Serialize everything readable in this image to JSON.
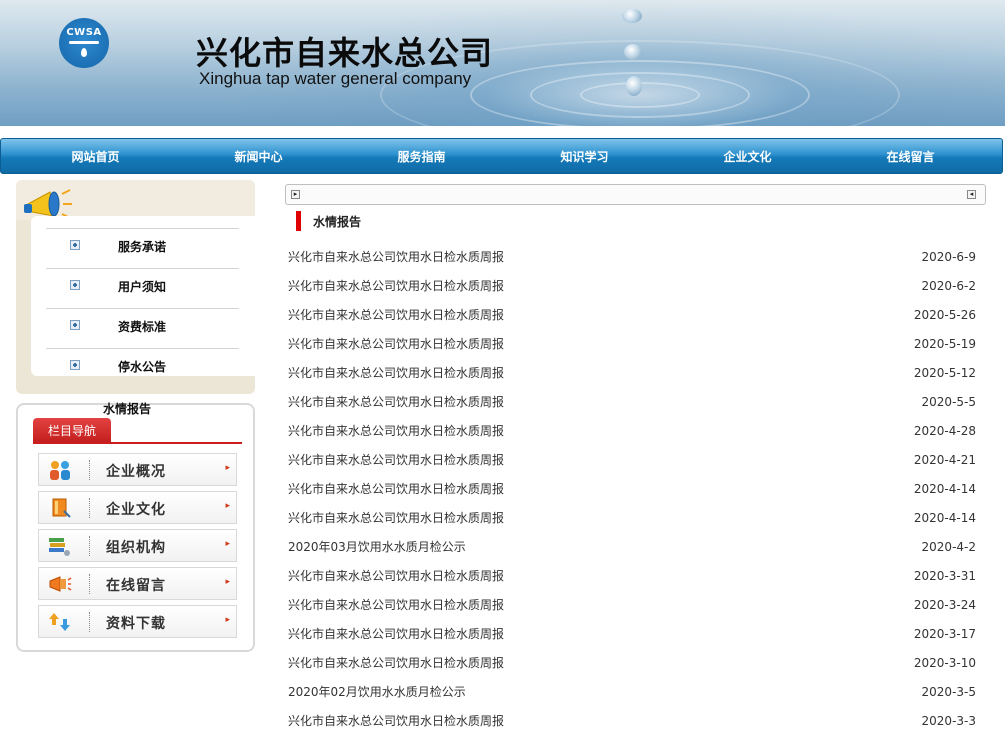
{
  "banner": {
    "logo_text": "CWSA",
    "title_cn": "兴化市自来水总公司",
    "title_en": "Xinghua tap water general company"
  },
  "nav": {
    "items": [
      "网站首页",
      "新闻中心",
      "服务指南",
      "知识学习",
      "企业文化",
      "在线留言"
    ]
  },
  "sidebar": {
    "sub_items": [
      "服务承诺",
      "用户须知",
      "资费标准",
      "停水公告"
    ],
    "sub_extra": "水情报告",
    "nav_tab": "栏目导航",
    "categories": [
      "企业概况",
      "企业文化",
      "组织机构",
      "在线留言",
      "资料下载"
    ]
  },
  "main": {
    "section_title": "水情报告",
    "news": [
      {
        "title": "兴化市自来水总公司饮用水日检水质周报",
        "date": "2020-6-9"
      },
      {
        "title": "兴化市自来水总公司饮用水日检水质周报",
        "date": "2020-6-2"
      },
      {
        "title": "兴化市自来水总公司饮用水日检水质周报",
        "date": "2020-5-26"
      },
      {
        "title": "兴化市自来水总公司饮用水日检水质周报",
        "date": "2020-5-19"
      },
      {
        "title": "兴化市自来水总公司饮用水日检水质周报",
        "date": "2020-5-12"
      },
      {
        "title": "兴化市自来水总公司饮用水日检水质周报",
        "date": "2020-5-5"
      },
      {
        "title": "兴化市自来水总公司饮用水日检水质周报",
        "date": "2020-4-28"
      },
      {
        "title": "兴化市自来水总公司饮用水日检水质周报",
        "date": "2020-4-21"
      },
      {
        "title": "兴化市自来水总公司饮用水日检水质周报",
        "date": "2020-4-14"
      },
      {
        "title": "兴化市自来水总公司饮用水日检水质周报",
        "date": "2020-4-14"
      },
      {
        "title": "2020年03月饮用水水质月检公示",
        "date": "2020-4-2"
      },
      {
        "title": "兴化市自来水总公司饮用水日检水质周报",
        "date": "2020-3-31"
      },
      {
        "title": "兴化市自来水总公司饮用水日检水质周报",
        "date": "2020-3-24"
      },
      {
        "title": "兴化市自来水总公司饮用水日检水质周报",
        "date": "2020-3-17"
      },
      {
        "title": "兴化市自来水总公司饮用水日检水质周报",
        "date": "2020-3-10"
      },
      {
        "title": "2020年02月饮用水水质月检公示",
        "date": "2020-3-5"
      },
      {
        "title": "兴化市自来水总公司饮用水日检水质周报",
        "date": "2020-3-3"
      }
    ]
  }
}
